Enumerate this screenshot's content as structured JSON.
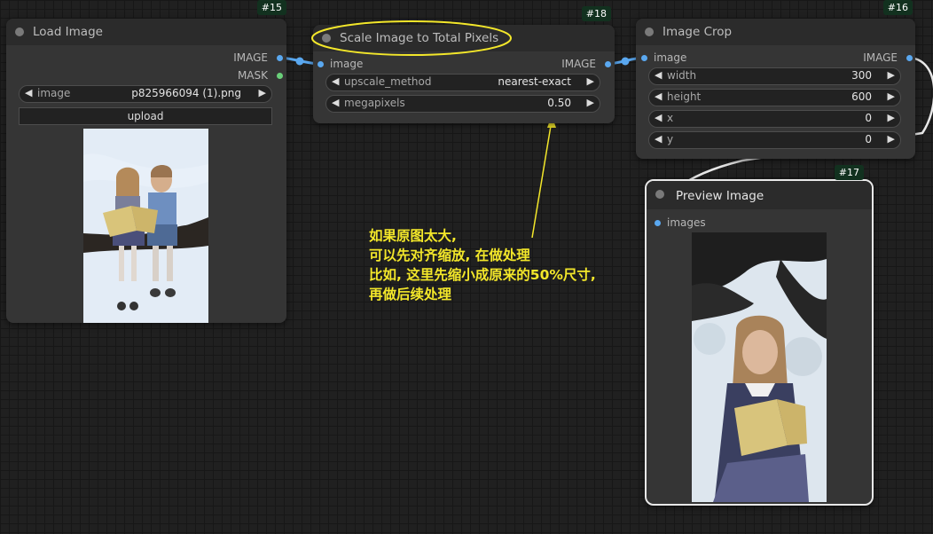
{
  "nodes": {
    "load_image": {
      "id": "#15",
      "title": "Load Image",
      "outputs": [
        "IMAGE",
        "MASK"
      ],
      "image_widget": {
        "name": "image",
        "value": "p825966094 (1).png"
      },
      "upload_label": "upload"
    },
    "scale_image": {
      "id": "#18",
      "title": "Scale Image to Total Pixels",
      "input": "image",
      "output": "IMAGE",
      "widgets": [
        {
          "name": "upscale_method",
          "value": "nearest-exact"
        },
        {
          "name": "megapixels",
          "value": "0.50"
        }
      ]
    },
    "image_crop": {
      "id": "#16",
      "title": "Image Crop",
      "input": "image",
      "output": "IMAGE",
      "widgets": [
        {
          "name": "width",
          "value": "300"
        },
        {
          "name": "height",
          "value": "600"
        },
        {
          "name": "x",
          "value": "0"
        },
        {
          "name": "y",
          "value": "0"
        }
      ]
    },
    "preview_image": {
      "id": "#17",
      "title": "Preview Image",
      "input": "images"
    }
  },
  "annotation": {
    "lines": [
      "如果原图太大,",
      "可以先对齐缩放, 在做处理",
      "比如, 这里先缩小成原来的50%尺寸,",
      "再做后续处理"
    ],
    "color": "#f3e72a"
  },
  "colors": {
    "canvas": "#202020",
    "node_body": "#353535",
    "node_header": "#2b2b2b",
    "image_slot": "#5aa8f0",
    "mask_slot": "#6ad07a",
    "highlight": "#f3e72a"
  },
  "icons": {
    "decrement": "◀",
    "increment": "▶"
  }
}
